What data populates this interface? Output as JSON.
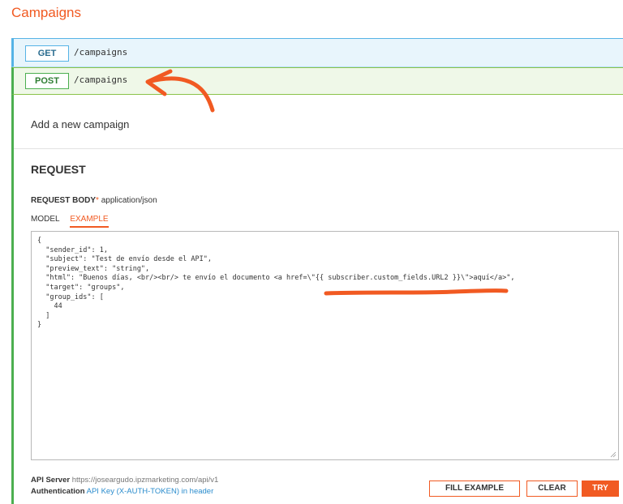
{
  "page": {
    "title": "Campaigns"
  },
  "endpoints": {
    "get": {
      "method": "GET",
      "path": "/campaigns"
    },
    "post": {
      "method": "POST",
      "path": "/campaigns"
    }
  },
  "operation": {
    "description": "Add a new campaign",
    "section_title": "REQUEST",
    "request_body_label": "REQUEST BODY",
    "required_mark": "*",
    "content_type": "application/json",
    "tabs": [
      {
        "label": "MODEL",
        "active": false
      },
      {
        "label": "EXAMPLE",
        "active": true
      }
    ],
    "example_body": "{\n  \"sender_id\": 1,\n  \"subject\": \"Test de envío desde el API\",\n  \"preview_text\": \"string\",\n  \"html\": \"Buenos días, <br/><br/> te envío el documento <a href=\\\"{{ subscriber.custom_fields.URL2 }}\\\">aquí</a>\",\n  \"target\": \"groups\",\n  \"group_ids\": [\n    44\n  ]\n}"
  },
  "footer": {
    "api_server_label": "API Server",
    "api_server_url": "https://joseargudo.ipzmarketing.com/api/v1",
    "auth_label": "Authentication",
    "auth_value": "API Key (X-AUTH-TOKEN) in header"
  },
  "buttons": {
    "fill_example": "FILL EXAMPLE",
    "clear": "CLEAR",
    "try": "TRY"
  },
  "colors": {
    "accent": "#f15a22",
    "get": "#56b3e6",
    "post": "#4caf50",
    "annotation": "#f15a22"
  }
}
